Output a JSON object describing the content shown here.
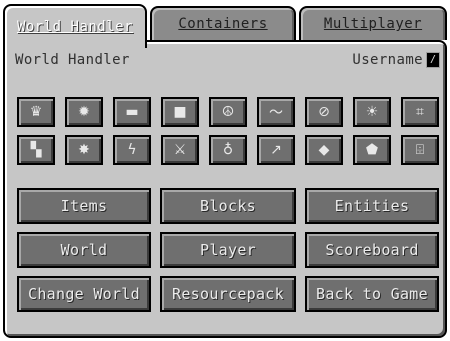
{
  "tabs": [
    {
      "label": "World Handler",
      "active": true
    },
    {
      "label": "Containers",
      "active": false
    },
    {
      "label": "Multiplayer",
      "active": false
    }
  ],
  "panel": {
    "title": "World Handler",
    "username_label": "Username",
    "username_value": "/"
  },
  "icon_buttons": [
    {
      "icon": "crown-icon",
      "glyph": "♛"
    },
    {
      "icon": "sun-icon",
      "glyph": "✹"
    },
    {
      "icon": "bar-icon",
      "glyph": "▬"
    },
    {
      "icon": "square-icon",
      "glyph": "■"
    },
    {
      "icon": "peace-icon",
      "glyph": "☮"
    },
    {
      "icon": "wave-icon",
      "glyph": "〜"
    },
    {
      "icon": "no-entry-icon",
      "glyph": "⊘"
    },
    {
      "icon": "bug-icon",
      "glyph": "☀"
    },
    {
      "icon": "hash-icon",
      "glyph": "⌗"
    },
    {
      "icon": "corner-icon",
      "glyph": "▚"
    },
    {
      "icon": "splat-icon",
      "glyph": "✸"
    },
    {
      "icon": "lightning-icon",
      "glyph": "ϟ"
    },
    {
      "icon": "sword-icon",
      "glyph": "⚔"
    },
    {
      "icon": "flask-icon",
      "glyph": "♁"
    },
    {
      "icon": "arrow-icon",
      "glyph": "↗"
    },
    {
      "icon": "diamond-icon",
      "glyph": "◆"
    },
    {
      "icon": "gem-icon",
      "glyph": "⬟"
    },
    {
      "icon": "tv-icon",
      "glyph": "⌹"
    }
  ],
  "buttons": [
    "Items",
    "Blocks",
    "Entities",
    "World",
    "Player",
    "Scoreboard",
    "Change World",
    "Resourcepack",
    "Back to Game"
  ]
}
